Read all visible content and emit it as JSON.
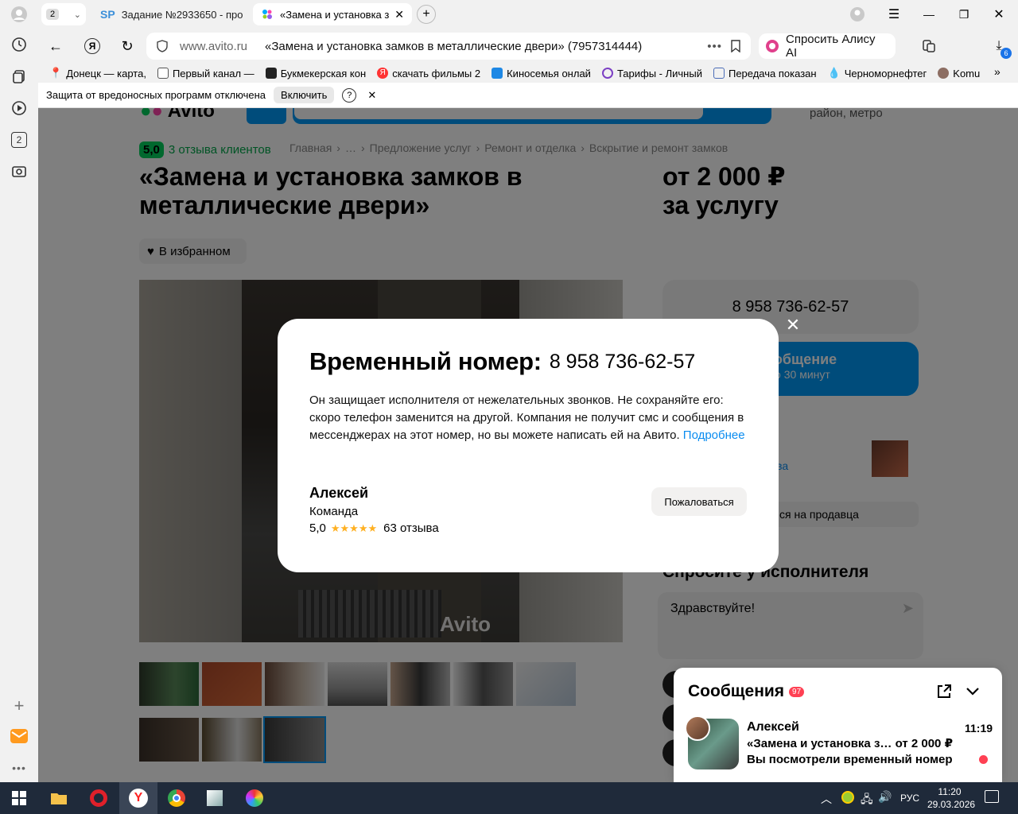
{
  "browser": {
    "tab_counter": "2",
    "tabs": [
      {
        "label": "Задание №2933650 - про"
      },
      {
        "label": "«Замена и установка з"
      }
    ],
    "address_domain": "www.avito.ru",
    "address_title": "«Замена и установка замков в металлические двери» (7957314444)",
    "alice_label": "Спросить Алису AI",
    "downloads_badge": "6",
    "bookmarks": [
      {
        "label": "Донецк — карта, "
      },
      {
        "label": "Первый канал — "
      },
      {
        "label": "Букмекерская кон"
      },
      {
        "label": "скачать фильмы 2"
      },
      {
        "label": "Киносемья онлай"
      },
      {
        "label": "Тарифы - Личный"
      },
      {
        "label": "Передача показан"
      },
      {
        "label": "Черноморнефтег"
      },
      {
        "label": "Komu"
      }
    ],
    "warning_text": "Защита от вредоносных программ отключена",
    "warning_button": "Включить",
    "warning_help": "?",
    "sidebar_badge": "2"
  },
  "listing": {
    "header_hint": "район, метро",
    "rating": "5,0",
    "reviews_link": "3 отзыва клиентов",
    "breadcrumb": [
      "Главная",
      "…",
      "Предложение услуг",
      "Ремонт и отделка",
      "Вскрытие и ремонт замков"
    ],
    "breadcrumb_sep": "›",
    "title": "«Замена и установка замков в металлические двери»",
    "price_line1": "от 2 000 ₽",
    "price_line2": "за услугу",
    "favorite_label": "В избранном",
    "phone_button": "8 958 736-62-57",
    "message_button_title": "ь сообщение",
    "message_button_sub": "около 30 минут",
    "reviews_partial": "ыва",
    "complain_partial": "ся на продавца",
    "ask_title": "Спросите у исполнителя",
    "ask_placeholder": "Здравствуйте!",
    "watermark": "Avito"
  },
  "modal": {
    "title": "Временный номер:",
    "phone": "8 958 736-62-57",
    "desc": "Он защищает исполнителя от нежелательных звонков. Не сохраняйте его: скоро телефон заменится на другой. Компания не получит смс и сообщения в мессенджерах на этот номер, но вы можете написать ей на Авито.",
    "more_link": "Подробнее",
    "seller_name": "Алексей",
    "seller_type": "Команда",
    "seller_rating": "5,0",
    "stars": "★★★★★",
    "seller_reviews": "63 отзыва",
    "complain_button": "Пожаловаться"
  },
  "messenger": {
    "title": "Сообщения",
    "badge": "97",
    "chat": {
      "name": "Алексей",
      "time": "11:19",
      "subject": "«Замена и установка з… от 2 000 ₽",
      "preview": "Вы посмотрели временный номер"
    }
  },
  "taskbar": {
    "lang": "РУС",
    "time": "11:20",
    "date": "29.03.2026"
  },
  "colors": {
    "accent_blue": "#0099f7",
    "link_blue": "#0a8cf0",
    "rating_green": "#02d15c",
    "star_orange": "#ffb021",
    "badge_red": "#ff4053"
  }
}
